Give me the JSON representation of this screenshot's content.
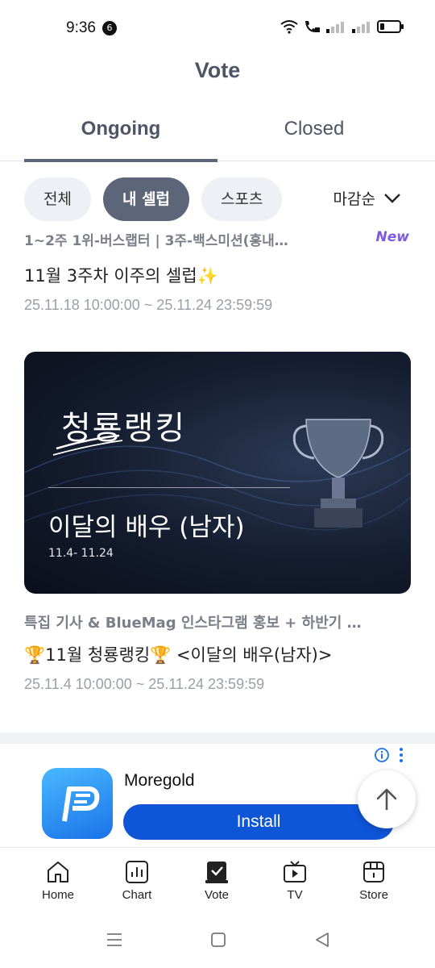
{
  "status_bar": {
    "time": "9:36",
    "notification_count": "6"
  },
  "header": {
    "title": "Vote"
  },
  "tabs": [
    {
      "label": "Ongoing"
    },
    {
      "label": "Closed"
    }
  ],
  "filters": [
    {
      "label": "전체"
    },
    {
      "label": "내 셀럽"
    },
    {
      "label": "스포츠"
    }
  ],
  "sort": {
    "label": "마감순"
  },
  "votes": [
    {
      "subtitle": "1~2주 1위-버스랩터 | 3주-백스미션(홍내…",
      "badge": "New",
      "title": "11월 3주차 이주의 셀럽✨",
      "date": "25.11.18 10:00:00 ~ 25.11.24 23:59:59"
    },
    {
      "banner_title": "청룡랭킹",
      "banner_subtitle": "이달의 배우 (남자)",
      "banner_range": "11.4- 11.24",
      "subtitle": "특집 기사 & BlueMag 인스타그램 홍보 + 하반기 …",
      "title": "🏆11월 청룡랭킹🏆 <이달의 배우(남자)>",
      "date": "25.11.4 10:00:00 ~ 25.11.24 23:59:59"
    }
  ],
  "ad": {
    "app_name": "Moregold",
    "install_label": "Install"
  },
  "bottom_nav": [
    {
      "label": "Home",
      "icon": "home-icon"
    },
    {
      "label": "Chart",
      "icon": "chart-icon"
    },
    {
      "label": "Vote",
      "icon": "vote-icon"
    },
    {
      "label": "TV",
      "icon": "tv-icon"
    },
    {
      "label": "Store",
      "icon": "store-icon"
    }
  ],
  "colors": {
    "accent": "#5d6578",
    "new_badge": "#7b5be0",
    "install_button": "#0f55d8"
  }
}
